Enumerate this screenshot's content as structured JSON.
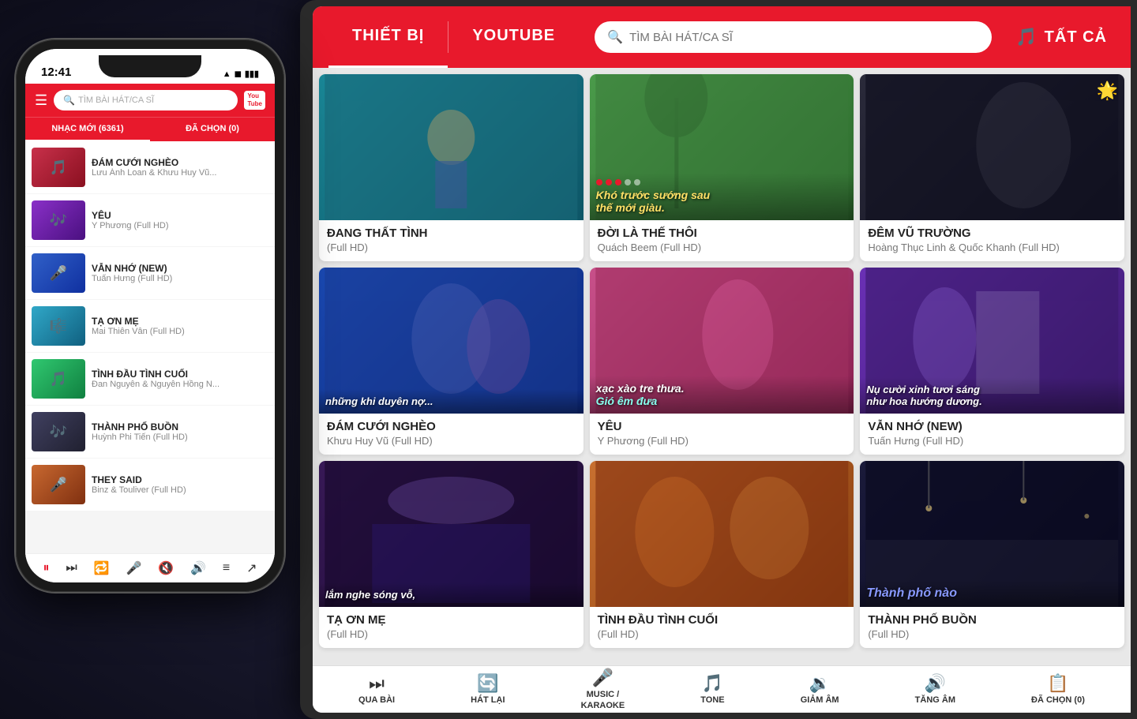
{
  "phone": {
    "time": "12:41",
    "status_icons": "▲ ◼ ▮",
    "header": {
      "search_placeholder": "TÌM BÀI HÁT/CA SĨ",
      "youtube_label": "You\nTube"
    },
    "tabs": [
      {
        "id": "new",
        "label": "NHẠC MỚI (6361)",
        "active": true
      },
      {
        "id": "chosen",
        "label": "ĐÃ CHỌN (0)",
        "active": false
      }
    ],
    "songs": [
      {
        "title": "ĐÁM CƯỚI NGHÈO",
        "sub": "Lưu Ánh Loan & Khưu Huy Vũ...",
        "bg": "pt-red"
      },
      {
        "title": "YÊU",
        "sub": "Y Phương (Full HD)",
        "bg": "pt-purple"
      },
      {
        "title": "VẪN NHỚ (NEW)",
        "sub": "Tuấn Hưng (Full HD)",
        "bg": "pt-blue2"
      },
      {
        "title": "TẠ ƠN MẸ",
        "sub": "Mai Thiên Vân (Full HD)",
        "bg": "pt-teal2"
      },
      {
        "title": "TÌNH ĐẦU TÌNH CUỐI",
        "sub": "Đan Nguyên & Nguyễn Hồng N...",
        "bg": "pt-green2"
      },
      {
        "title": "THÀNH PHỐ BUỒN",
        "sub": "Huỳnh Phi Tiến (Full HD)",
        "bg": "pt-dark2"
      },
      {
        "title": "THEY SAID",
        "sub": "Binz & Touliver (Full HD)",
        "bg": "pt-warm"
      }
    ],
    "controls": [
      "⏸",
      "⏭",
      "🔁",
      "🎤",
      "🔇",
      "🔊",
      "≡",
      "↗"
    ]
  },
  "tablet": {
    "tabs": [
      {
        "label": "THIẾT BỊ",
        "active": true
      },
      {
        "label": "YOUTUBE",
        "active": false
      }
    ],
    "search_placeholder": "TÌM BÀI HÁT/CA SĨ",
    "tat_ca": "TẤT CẢ",
    "videos": [
      {
        "title": "ĐANG THẤT TÌNH",
        "sub": "(Full HD)",
        "bg": "bg-teal",
        "overlay": "",
        "overlay_class": ""
      },
      {
        "title": "ĐỜI LÀ THẾ THÔI",
        "sub": "Quách Beem (Full HD)",
        "bg": "bg-green",
        "overlay": "Khó trước sướng sau\nthế mới giàu.",
        "overlay_class": "yellow"
      },
      {
        "title": "ĐÊM VŨ TRƯỜNG",
        "sub": "Hoàng Thục Linh & Quốc Khanh (Full HD)",
        "bg": "bg-dark",
        "overlay": "",
        "overlay_class": "",
        "badge": "🌟"
      },
      {
        "title": "ĐÁM CƯỚI NGHÈO",
        "sub": "Khưu Huy Vũ (Full HD)",
        "bg": "bg-blue",
        "overlay": "những khi duyên nợ...",
        "overlay_class": "white"
      },
      {
        "title": "YÊU",
        "sub": "Y Phương (Full HD)",
        "bg": "bg-pink",
        "overlay": "xạc xào tre thưa.\nGió êm đưa",
        "overlay_class": "cyan"
      },
      {
        "title": "VẪN NHỚ (NEW)",
        "sub": "Tuấn Hưng (Full HD)",
        "bg": "bg-purple",
        "overlay": "Nụ cười xinh tươi sáng\nnhư hoa hướng dương.",
        "overlay_class": "white"
      },
      {
        "title": "TẠ ƠN MẸ",
        "sub": "(Full HD)",
        "bg": "bg-stage",
        "overlay": "lắm nghe sóng vỗ,",
        "overlay_class": "white"
      },
      {
        "title": "TÌNH ĐẦU TÌNH CUỐI",
        "sub": "(Full HD)",
        "bg": "bg-orange",
        "overlay": "",
        "overlay_class": ""
      },
      {
        "title": "THÀNH PHỐ BUỒN",
        "sub": "(Full HD)",
        "bg": "bg-night",
        "overlay": "Thành phố nào",
        "overlay_class": "blue bold"
      }
    ],
    "bottom_controls": [
      {
        "icon": "⏭",
        "label": "QUA BÀI"
      },
      {
        "icon": "🔄",
        "label": "HÁT LẠI"
      },
      {
        "icon": "🎤",
        "label": "MUSIC /\nKARAOKE"
      },
      {
        "icon": "🎵",
        "label": "TONE"
      },
      {
        "icon": "🔉",
        "label": "GIẢM ÂM"
      },
      {
        "icon": "🔊",
        "label": "TĂNG ÂM"
      },
      {
        "icon": "📋",
        "label": "ĐÃ CHỌN (0)"
      }
    ]
  }
}
